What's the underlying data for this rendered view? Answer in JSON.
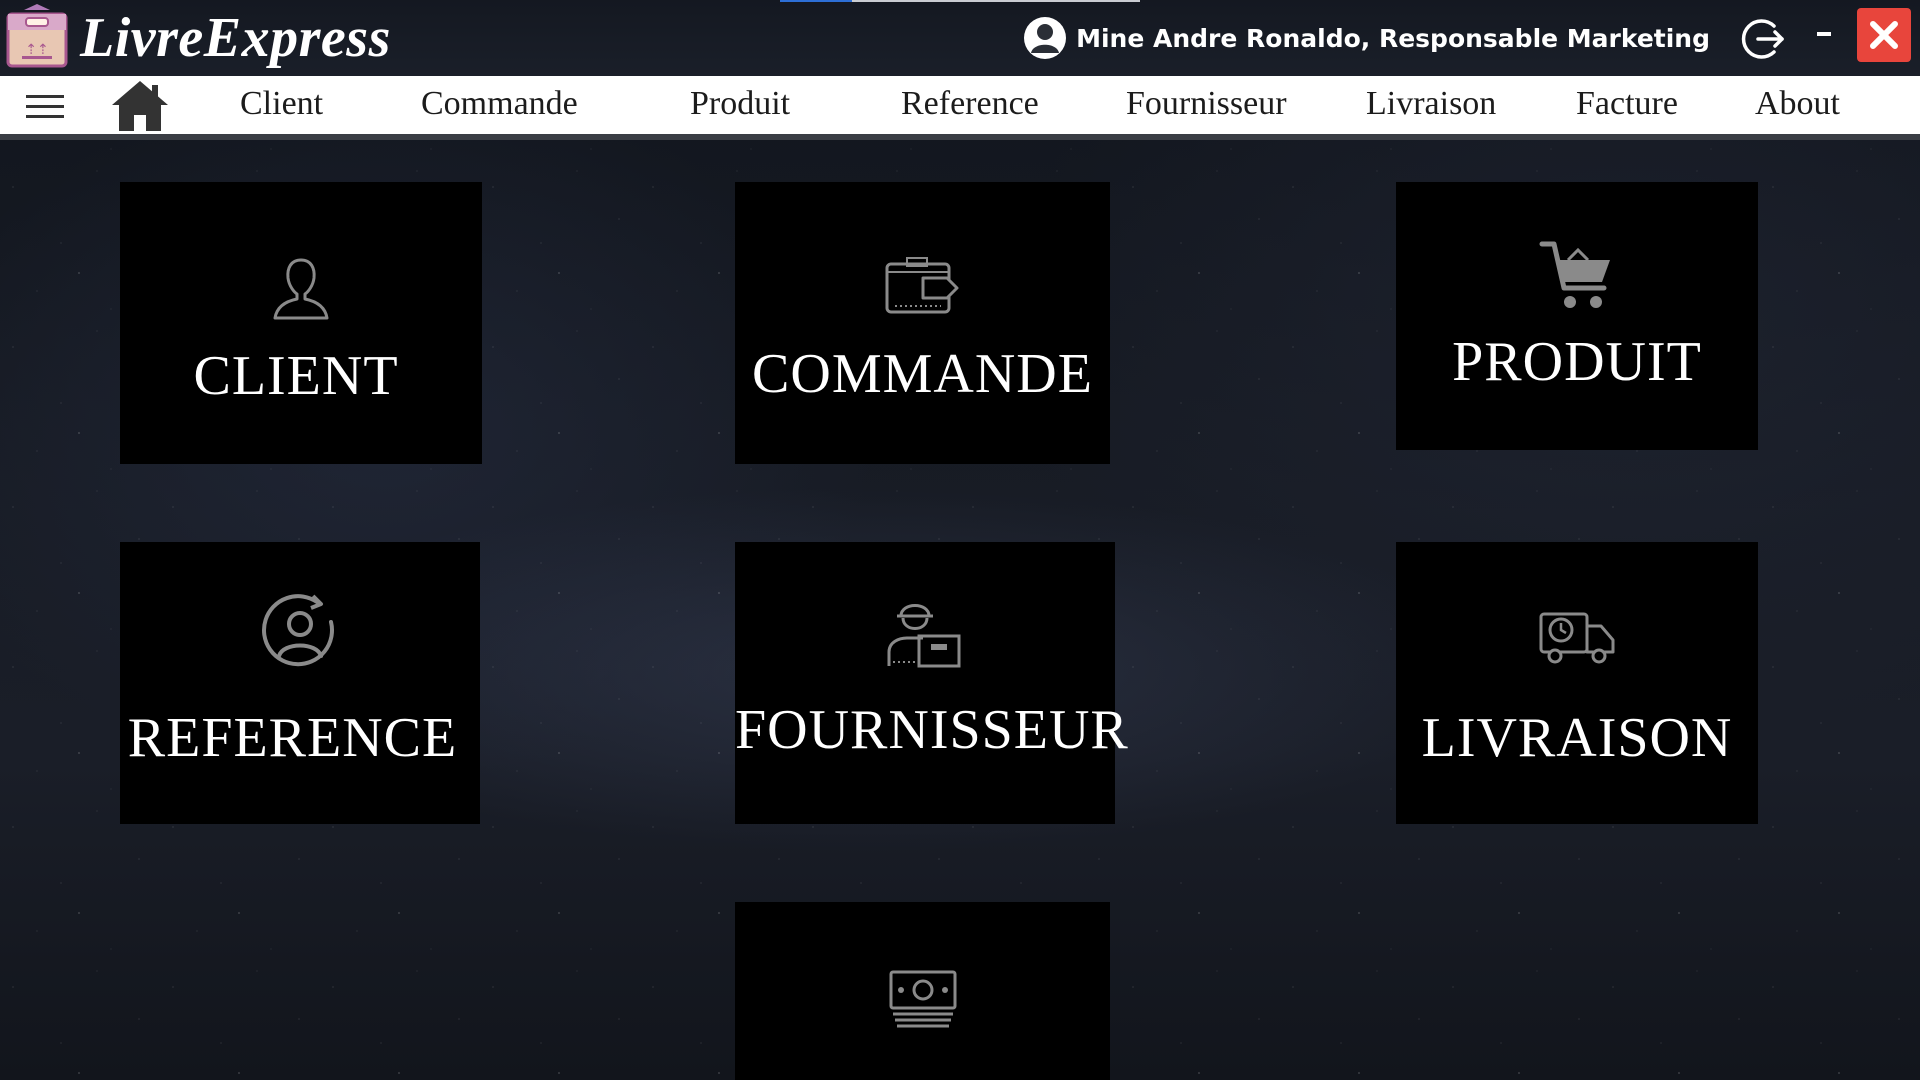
{
  "window": {
    "app_title": "LivreExpress",
    "user_label": "Mine Andre Ronaldo, Responsable Marketing",
    "progress_fraction": 0.2
  },
  "nav": {
    "items": [
      {
        "label": "Client"
      },
      {
        "label": "Commande"
      },
      {
        "label": "Produit"
      },
      {
        "label": "Reference"
      },
      {
        "label": "Fournisseur"
      },
      {
        "label": "Livraison"
      },
      {
        "label": "Facture"
      },
      {
        "label": "About"
      }
    ]
  },
  "tiles": [
    {
      "label": "CLIENT",
      "icon": "user-icon"
    },
    {
      "label": "COMMANDE",
      "icon": "wallet-icon"
    },
    {
      "label": "PRODUIT",
      "icon": "cart-icon"
    },
    {
      "label": "REFERENCE",
      "icon": "user-refresh-icon"
    },
    {
      "label": "FOURNISSEUR",
      "icon": "worker-box-icon"
    },
    {
      "label": "LIVRAISON",
      "icon": "delivery-truck-icon"
    },
    {
      "label": "",
      "icon": "money-icon"
    }
  ],
  "colors": {
    "close_button": "#e8453c",
    "progress_fill": "#2d6fd6",
    "tile_background": "#000000",
    "nav_background": "#ffffff"
  }
}
